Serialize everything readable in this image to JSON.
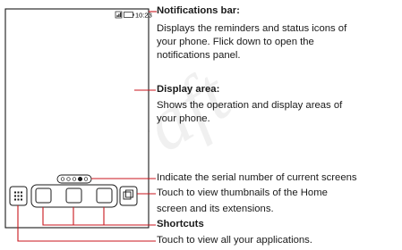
{
  "status_bar": {
    "time": "10:23"
  },
  "watermark": "Draft",
  "screen_indicator": {
    "dot_count": 5,
    "current_index": 3
  },
  "callouts": {
    "notifications_bar": {
      "title": "Notifications bar:",
      "lines": [
        "Displays the reminders and status icons of",
        "your phone. Flick down to open the",
        "notifications panel."
      ]
    },
    "display_area": {
      "title": "Display area:",
      "lines": [
        "Shows the operation and display areas of",
        "your phone."
      ]
    },
    "screen_indicator": {
      "lines": [
        "Indicate the serial number of current screens"
      ]
    },
    "thumbnails_button": {
      "lines": [
        "Touch to view thumbnails of the Home",
        "screen and its extensions."
      ]
    },
    "shortcuts": {
      "title": "Shortcuts"
    },
    "all_apps_button": {
      "lines": [
        "Touch to view all your applications."
      ]
    }
  },
  "colors": {
    "outline": "#1a1a1a",
    "red_line": "#c8161d",
    "status_text": "#1a1a1a"
  },
  "icons": [
    "signal-icon",
    "battery-icon",
    "app-grid-icon",
    "thumbnails-icon"
  ]
}
